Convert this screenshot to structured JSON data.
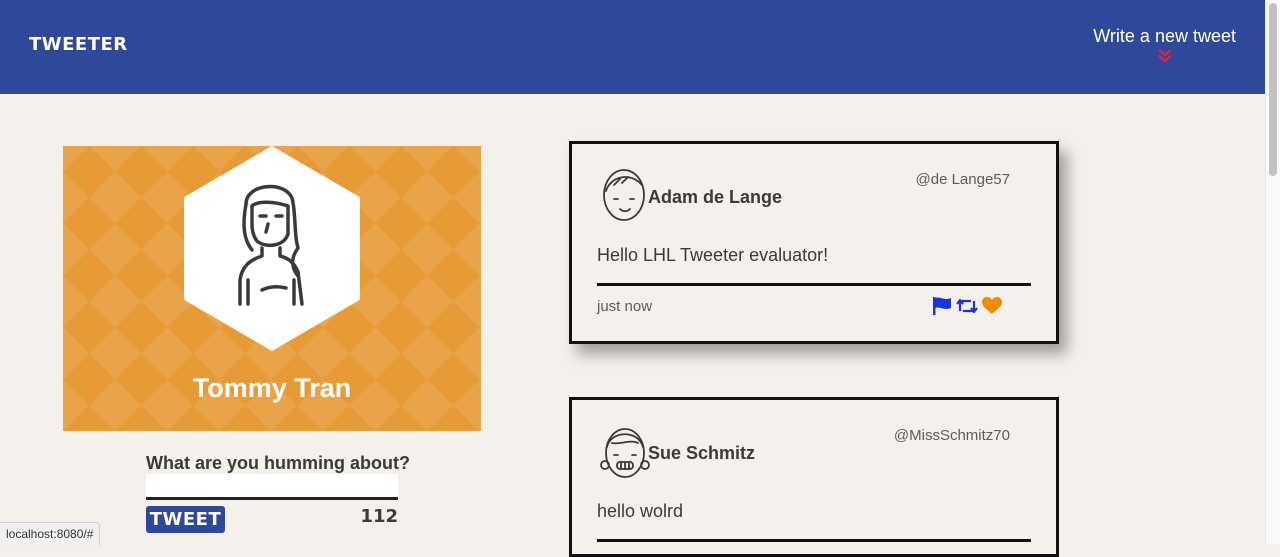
{
  "nav": {
    "brand": "TWEETER",
    "compose_label": "Write a new tweet",
    "compose_icon": "double-chevron-down-icon",
    "background": "#30489a",
    "chevron_color": "#e0253b"
  },
  "profile": {
    "name": "Tommy Tran",
    "background": "#e79b37"
  },
  "compose_form": {
    "question": "What are you humming about?",
    "input_value": "",
    "button_label": "TWEET",
    "counter": "112"
  },
  "tweets": [
    {
      "name": "Adam de Lange",
      "handle": "@de Lange57",
      "text": "Hello LHL Tweeter evaluator!",
      "time": "just now",
      "actions": [
        "flag-icon",
        "retweet-icon",
        "heart-icon"
      ]
    },
    {
      "name": "Sue Schmitz",
      "handle": "@MissSchmitz70",
      "text": "hello wolrd"
    }
  ],
  "colors": {
    "flag": "#1a32e0",
    "retweet": "#1a32e0",
    "heart": "#f08a00"
  },
  "status_bar": {
    "url": "localhost:8080/#"
  }
}
